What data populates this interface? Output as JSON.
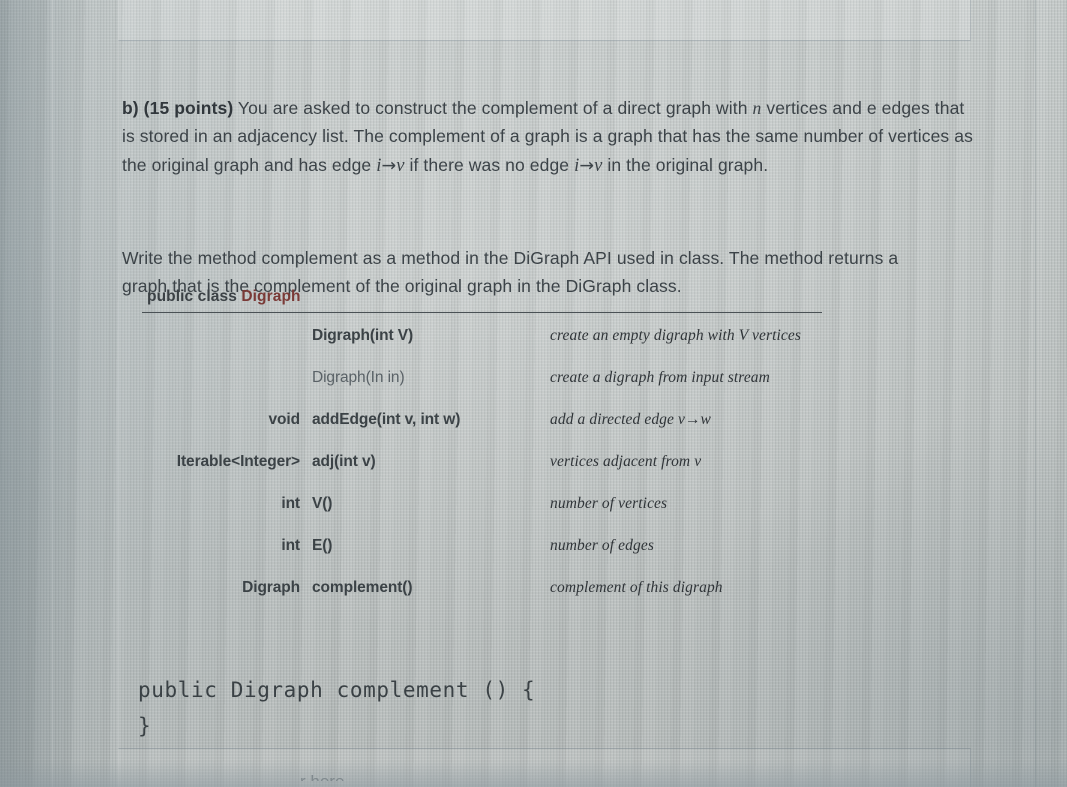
{
  "document": {
    "question_label": "b) (15 points)",
    "paragraph_1_part1": " You are asked to construct the complement of a direct graph with ",
    "paragraph_1_var_n": "n",
    "paragraph_1_part2": " vertices and e edges that is stored in an adjacency list. The complement of a graph is a graph that has the same number of vertices as the original graph and has edge ",
    "paragraph_1_var_i1": "i",
    "paragraph_1_arrow1": "→",
    "paragraph_1_var_v1": "v",
    "paragraph_1_part3": " if there was no edge ",
    "paragraph_1_var_i2": "i",
    "paragraph_1_arrow2": "→",
    "paragraph_1_var_v2": "v",
    "paragraph_1_part4": " in the original graph.",
    "paragraph_2": "Write the method complement as a method in the DiGraph API used in class. The method returns a graph that is the complement of the original graph in the DiGraph class."
  },
  "api": {
    "title_prefix": "public class ",
    "title_class": "Digraph",
    "rows": [
      {
        "return_type": "",
        "signature": "Digraph(int V)",
        "description": "create an empty digraph with V vertices"
      },
      {
        "return_type": "",
        "signature": "Digraph(In in)",
        "description": "create a digraph from input stream"
      },
      {
        "return_type": "void",
        "signature": "addEdge(int v, int w)",
        "description": "add a directed edge v→w"
      },
      {
        "return_type": "Iterable<Integer>",
        "signature": "adj(int v)",
        "description": "vertices adjacent from v"
      },
      {
        "return_type": "int",
        "signature": "V()",
        "description": "number of vertices"
      },
      {
        "return_type": "int",
        "signature": "E()",
        "description": "number of edges"
      },
      {
        "return_type": "Digraph",
        "signature": "complement()",
        "description": "complement of this digraph"
      }
    ]
  },
  "code": {
    "line_1": "public Digraph complement () {",
    "line_2": "}"
  },
  "chrome": {
    "clipped_bottom_text": "r here"
  },
  "colors": {
    "background": "#c6cccb",
    "body_text": "#3c4348",
    "class_name": "#7a3a37",
    "rule": "#4a5155",
    "code_text": "#3a4145"
  }
}
